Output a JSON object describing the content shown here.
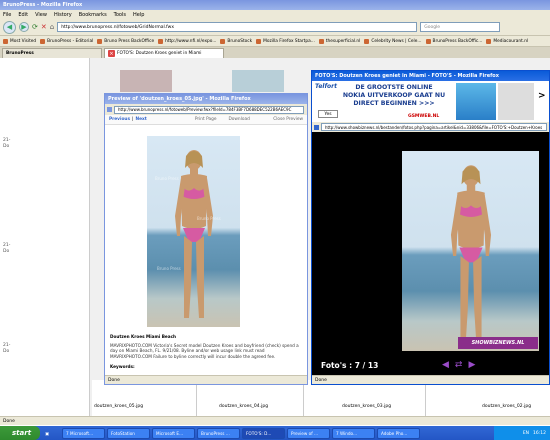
{
  "main_window": {
    "title": "BrunoPress - Mozilla Firefox",
    "menu": [
      "File",
      "Edit",
      "View",
      "History",
      "Bookmarks",
      "Tools",
      "Help"
    ],
    "url": "http://www.brunopress.nl/fotoweb/GridNormal.fwx",
    "search_placeholder": "Google",
    "bookmarks": [
      "Most Visited",
      "BrunoPress - Editorial",
      "Bruno Press BackOffice",
      "http://www.nfi.nl/expo...",
      "BrunoStock",
      "Mozilla Firefox Startpa...",
      "thesuperficial.nl",
      "Celebrity News | Cele...",
      "BrunoPress BackOffic...",
      "Mediacourant.nl"
    ],
    "tabs": [
      "BrunoPress",
      "FOTO'S: Doutzen Kroes geniet in Miami"
    ],
    "left_sidebar": [
      "21-",
      "Do",
      "21-",
      "Do",
      "21-",
      "Do"
    ],
    "thumb_labels": [
      "doutzen_kroes_05.jpg",
      "doutzen_kroes_04.jpg",
      "doutzen_kroes_03.jpg",
      "doutzen_kroes_02.jpg"
    ],
    "status": "Done"
  },
  "preview_window": {
    "title": "Preview of 'doutzen_kroes_05.jpg' - Mozilla Firefox",
    "url": "http://www.brunopress.nl/fotoweb/Preview.fwx?fileId=784F3BF7D688DEC522B6AEC9C",
    "previous": "Previous",
    "next": "Next",
    "print": "Print Page",
    "download": "Download",
    "close": "Close Preview",
    "watermark": "Bruno Press",
    "caption_title": "Doutzen Kroes Miami Beach",
    "caption_body": "MAVRIXPHOTO.COM Victoria's Secret model Doutzen Kroes and boyfriend (check) spend a day on Miami Beach, FL. 9/21/08. Byline and/or web usage link must read MAVRIXPHOTO.COM Failure to byline correctly will incur double the agreed fee.",
    "keywords_label": "Keywords:",
    "status": "Done"
  },
  "showbiz_window": {
    "title": "FOTO'S: Doutzen Kroes geniet in Miami - FOTO'S - Mozilla Firefox",
    "url": "http://www.showbiznews.nl/bestanden/fotos.php?pagina=artikel&nid=33806&file=FOTO'S:+Doutzen+Kroes",
    "ad_brand": "Telfort",
    "ad_line1": "DE GROOTSTE ONLINE",
    "ad_line2": "NOKIA UITVERKOOP GAAT NU",
    "ad_line3": "DIRECT BEGINNEN >>>",
    "ad_yes": "Yes",
    "ad_site": "GSMWEB.NL",
    "photo_brand": "SHOWBIZNEWS.NL",
    "counter": "Foto's : 7 / 13",
    "status": "Done"
  },
  "taskbar": {
    "start": "start",
    "tasks": [
      "7 Microsoft...",
      "FotoStation",
      "Microsoft E...",
      "BrunoPress ...",
      "FOTO'S: D...",
      "Preview of ...",
      "7 Windo...",
      "Adobe Pho..."
    ],
    "lang": "EN",
    "clock": "16:12"
  }
}
